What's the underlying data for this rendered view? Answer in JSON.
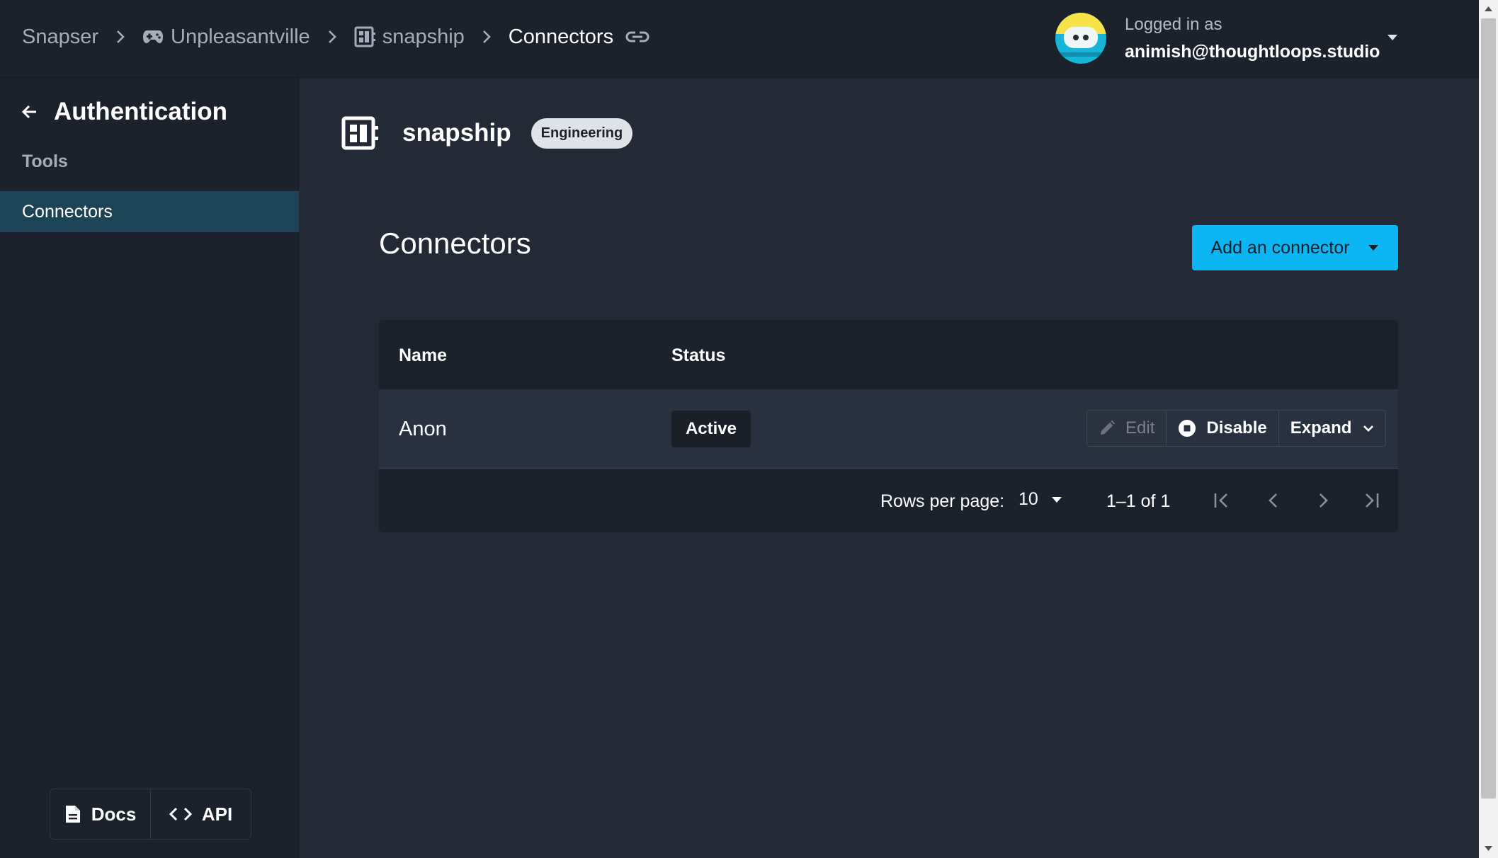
{
  "breadcrumbs": {
    "root": "Snapser",
    "company": "Unpleasantville",
    "project": "snapship",
    "current": "Connectors"
  },
  "user": {
    "label": "Logged in as",
    "email": "animish@thoughtloops.studio"
  },
  "sidebar": {
    "title": "Authentication",
    "section": "Tools",
    "items": [
      {
        "label": "Connectors",
        "active": true
      }
    ],
    "footer": {
      "docs": "Docs",
      "api": "API"
    }
  },
  "project": {
    "name": "snapship",
    "badge": "Engineering"
  },
  "page": {
    "title": "Connectors",
    "add_button": "Add an connector"
  },
  "table": {
    "columns": [
      "Name",
      "Status"
    ],
    "rows": [
      {
        "name": "Anon",
        "status": "Active",
        "actions": {
          "edit": "Edit",
          "disable": "Disable",
          "expand": "Expand"
        }
      }
    ],
    "footer": {
      "rows_per_page_label": "Rows per page:",
      "rows_per_page": "10",
      "range": "1–1 of 1"
    }
  },
  "colors": {
    "background": "#232a36",
    "panel": "#1c222c",
    "accent": "#0bb6f2",
    "active_nav": "#1d4356"
  },
  "icons": [
    "gamepad-icon",
    "dashboard-icon",
    "link-icon",
    "arrow-left-icon",
    "document-icon",
    "code-icon",
    "pencil-icon",
    "stop-circle-icon",
    "chevron-down-icon",
    "first-page-icon",
    "prev-page-icon",
    "next-page-icon",
    "last-page-icon"
  ]
}
